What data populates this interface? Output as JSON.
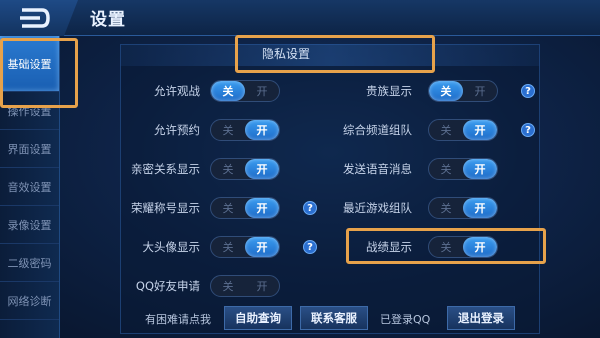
{
  "header": {
    "title": "设置"
  },
  "sidebar": {
    "items": [
      {
        "label": "基础设置"
      },
      {
        "label": "操作设置"
      },
      {
        "label": "界面设置"
      },
      {
        "label": "音效设置"
      },
      {
        "label": "录像设置"
      },
      {
        "label": "二级密码"
      },
      {
        "label": "网络诊断"
      }
    ],
    "active_index": 0
  },
  "section": {
    "title": "隐私设置"
  },
  "toggle_text": {
    "off": "关",
    "on": "开"
  },
  "options_left": [
    {
      "label": "允许观战",
      "state": "off"
    },
    {
      "label": "允许预约",
      "state": "on"
    },
    {
      "label": "亲密关系显示",
      "state": "on"
    },
    {
      "label": "荣耀称号显示",
      "state": "on",
      "help": true
    },
    {
      "label": "大头像显示",
      "state": "on",
      "help": true
    },
    {
      "label": "QQ好友申请",
      "state": "off"
    }
  ],
  "options_right": [
    {
      "label": "贵族显示",
      "state": "off",
      "help": true
    },
    {
      "label": "综合频道组队",
      "state": "on",
      "help": true
    },
    {
      "label": "发送语音消息",
      "state": "on"
    },
    {
      "label": "最近游戏组队",
      "state": "on"
    },
    {
      "label": "战绩显示",
      "state": "on"
    }
  ],
  "help_mark": "?",
  "footer": {
    "help_text": "有困难请点我",
    "self_query": "自助查询",
    "contact_service": "联系客服",
    "logged_in": "已登录QQ",
    "logout": "退出登录"
  },
  "colors": {
    "accent": "#2b7fe0",
    "highlight_box": "#e7a24b"
  }
}
